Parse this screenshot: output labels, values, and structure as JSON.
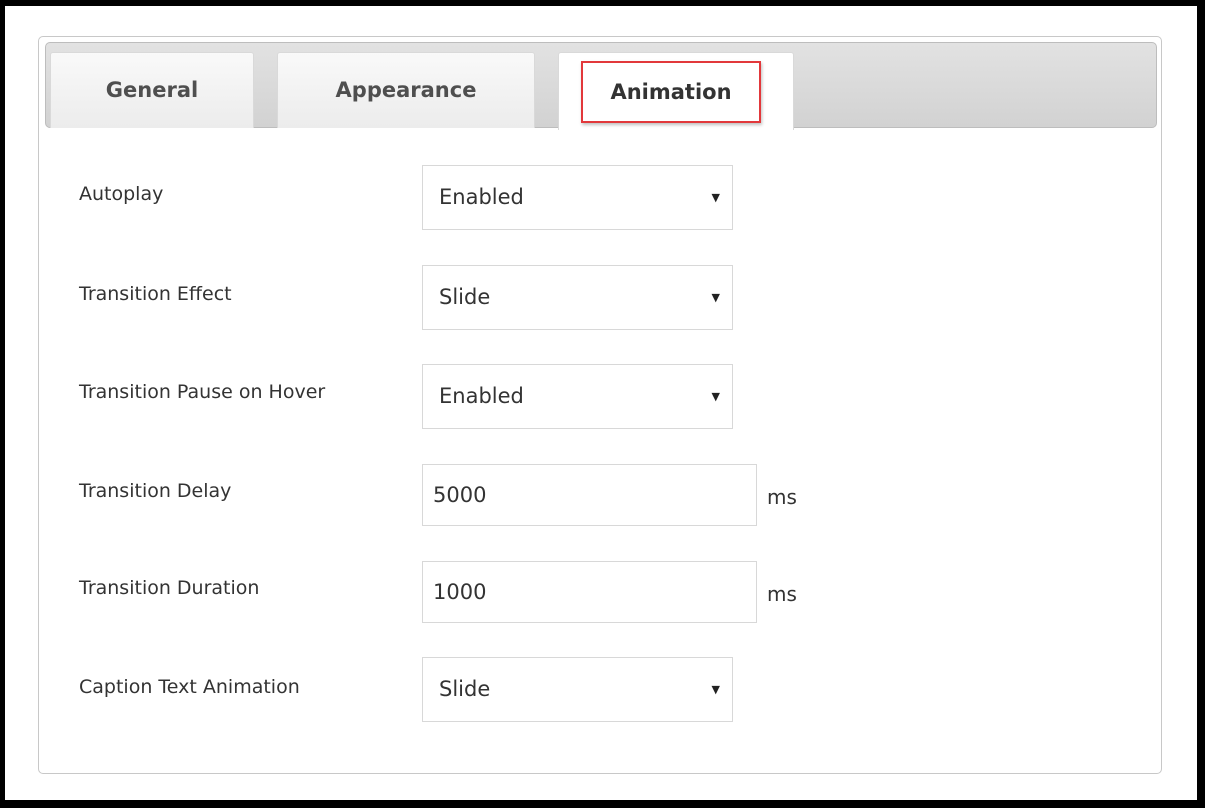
{
  "tabs": {
    "general": "General",
    "appearance": "Appearance",
    "animation": "Animation"
  },
  "fields": {
    "autoplay": {
      "label": "Autoplay",
      "value": "Enabled"
    },
    "transition_effect": {
      "label": "Transition Effect",
      "value": "Slide"
    },
    "pause_on_hover": {
      "label": "Transition Pause on Hover",
      "value": "Enabled"
    },
    "transition_delay": {
      "label": "Transition Delay",
      "value": "5000",
      "unit": "ms"
    },
    "transition_duration": {
      "label": "Transition Duration",
      "value": "1000",
      "unit": "ms"
    },
    "caption_animation": {
      "label": "Caption Text Animation",
      "value": "Slide"
    }
  },
  "icons": {
    "dropdown": "caret-down-icon"
  },
  "colors": {
    "active_tab_highlight": "#e2383b"
  }
}
